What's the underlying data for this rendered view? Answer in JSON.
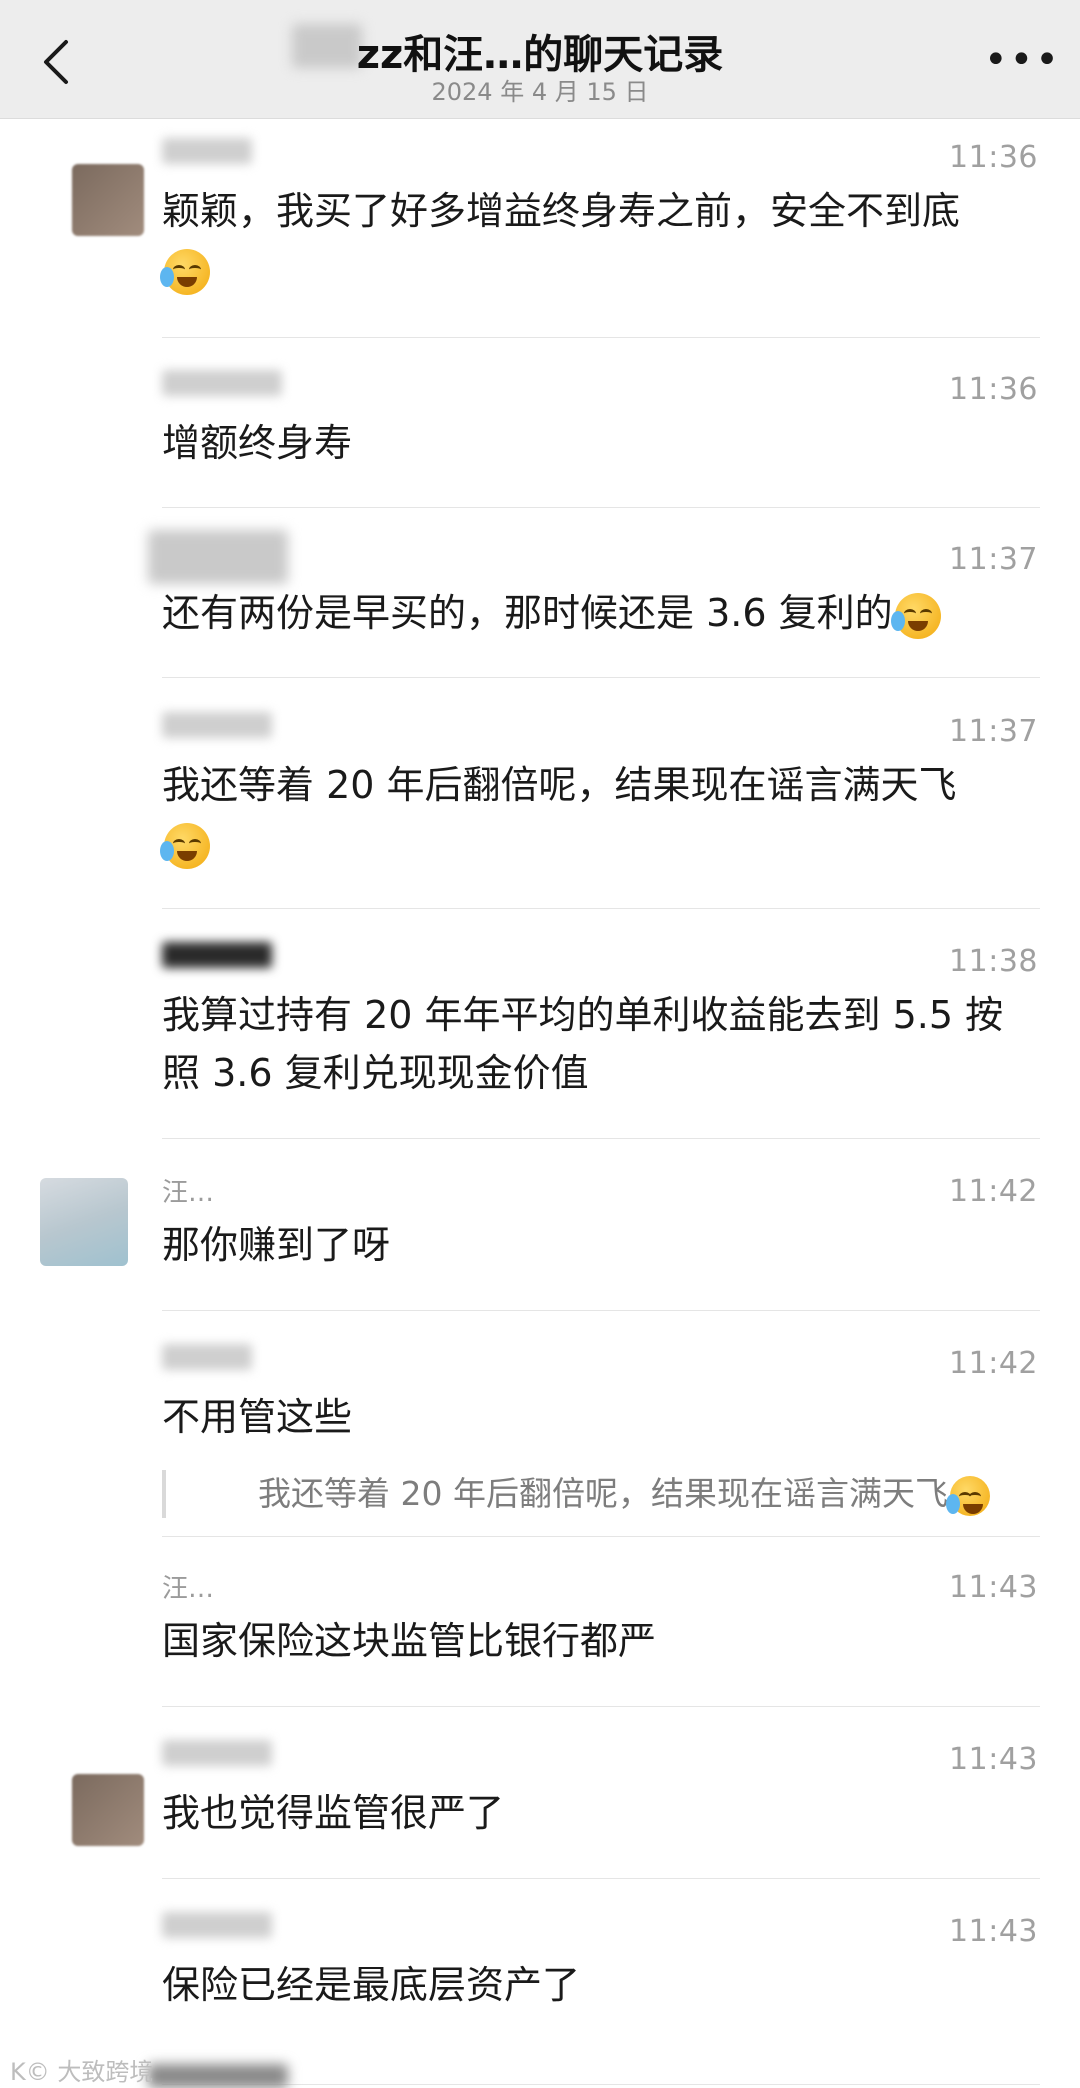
{
  "header": {
    "title": "zz和汪…的聊天记录",
    "date": "2024 年 4 月 15 日",
    "back_icon": "chevron-left-icon",
    "more_label": "•••"
  },
  "messages": [
    {
      "sender": "…",
      "time": "11:36",
      "text": "颖颖，我买了好多增益终身寿之前，安全不到底"
    },
    {
      "sender": "",
      "time": "11:36",
      "text": "增额终身寿"
    },
    {
      "sender": "",
      "time": "11:37",
      "text": "还有两份是早买的，那时候还是 3.6 复利的"
    },
    {
      "sender": "",
      "time": "11:37",
      "text": "我还等着 20 年后翻倍呢，结果现在谣言满天飞"
    },
    {
      "sender": "",
      "time": "11:38",
      "text": "我算过持有 20 年年平均的单利收益能去到 5.5 按照 3.6 复利兑现现金价值"
    },
    {
      "sender": "汪…",
      "time": "11:42",
      "text": "那你赚到了呀"
    },
    {
      "sender": "",
      "time": "11:42",
      "text": "不用管这些",
      "quote": "我还等着 20 年后翻倍呢，结果现在谣言满天飞"
    },
    {
      "sender": "汪…",
      "time": "11:43",
      "text": "国家保险这块监管比银行都严"
    },
    {
      "sender": "",
      "time": "11:43",
      "text": "我也觉得监管很严了"
    },
    {
      "sender": "",
      "time": "11:43",
      "text": "保险已经是最底层资产了"
    }
  ],
  "watermark": "K© 大致跨境",
  "colors": {
    "header_bg": "#ededed",
    "divider": "#e5e5e5",
    "time": "#a0a0a0"
  }
}
